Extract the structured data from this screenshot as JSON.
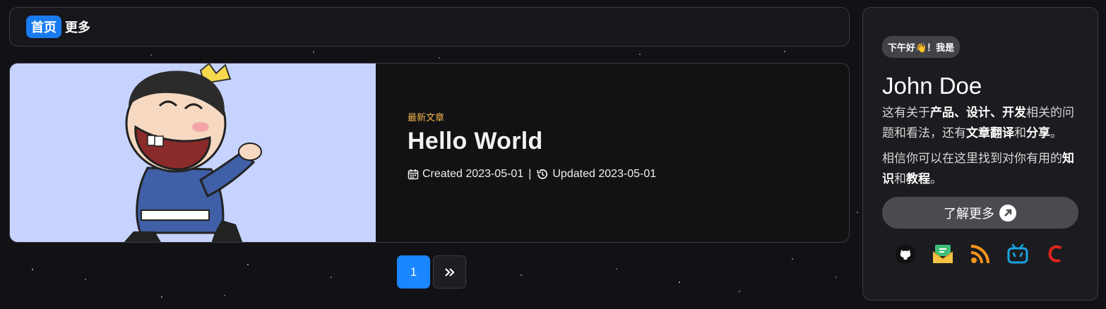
{
  "nav": {
    "items": [
      "首页",
      "更多"
    ],
    "active_index": 0
  },
  "post": {
    "tag": "最新文章",
    "title": "Hello World",
    "created": "Created 2023-05-01",
    "separator": "|",
    "updated": "Updated 2023-05-01",
    "icons": [
      "calendar-icon",
      "history-icon"
    ]
  },
  "pagination": {
    "current": "1",
    "next_icon": "double-chevron-right-icon"
  },
  "profile": {
    "greeting": "下午好👋！我是",
    "name": "John Doe",
    "intro1": {
      "a": "这有关于",
      "b": "产品、设计、开发",
      "c": "相关的问题和看法，还有",
      "d": "文章翻译",
      "e": "和",
      "f": "分享",
      "g": "。"
    },
    "intro2": {
      "a": "相信你可以在这里找到对你有用的",
      "b": "知识",
      "c": "和",
      "d": "教程",
      "e": "。"
    },
    "button": "了解更多",
    "button_icon": "arrow-up-right-icon",
    "social_icons": [
      "github-icon",
      "email-icon",
      "rss-icon",
      "bilibili-icon",
      "csdn-icon"
    ]
  },
  "colors": {
    "accent": "#1a86ff",
    "tag": "#f2b24a",
    "cover_bg": "#c6d3ff"
  }
}
